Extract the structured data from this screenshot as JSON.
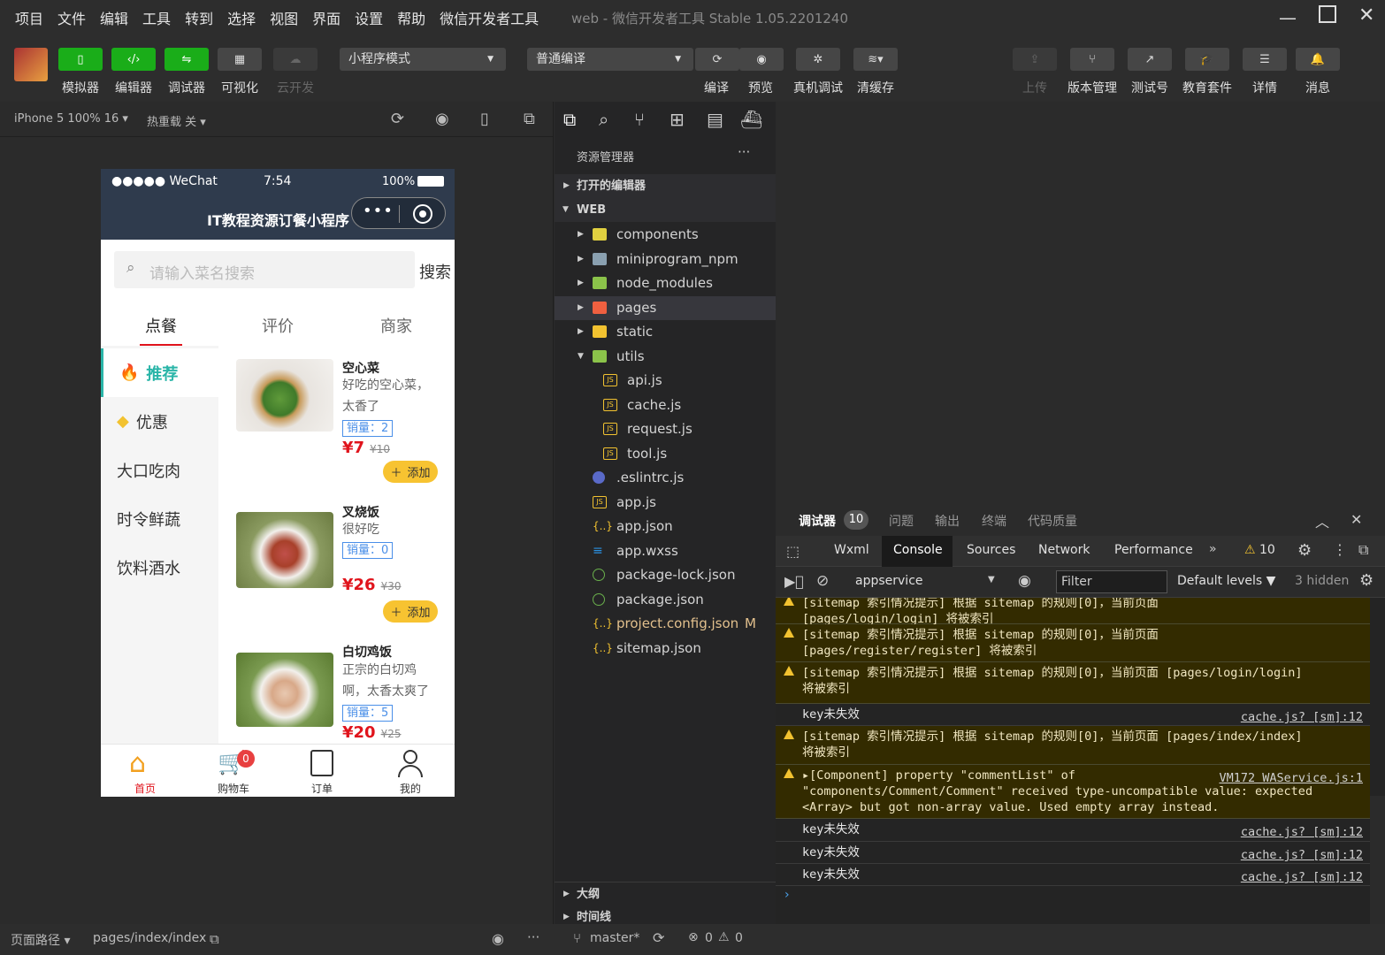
{
  "menu": [
    "项目",
    "文件",
    "编辑",
    "工具",
    "转到",
    "选择",
    "视图",
    "界面",
    "设置",
    "帮助",
    "微信开发者工具"
  ],
  "window_title": "web - 微信开发者工具 Stable 1.05.2201240",
  "toolbar": {
    "simulator": "模拟器",
    "editor": "编辑器",
    "debugger": "调试器",
    "visual": "可视化",
    "cloud": "云开发",
    "mode": "小程序模式",
    "compile_mode": "普通编译",
    "compile": "编译",
    "preview": "预览",
    "real_debug": "真机调试",
    "clear_cache": "清缓存",
    "upload": "上传",
    "version": "版本管理",
    "test_id": "测试号",
    "edu": "教育套件",
    "details": "详情",
    "messages": "消息"
  },
  "sim": {
    "device": "iPhone 5 100% 16 ▾",
    "hot_reload": "热重载 关 ▾"
  },
  "phone": {
    "carrier": "●●●●● WeChat",
    "time": "7:54",
    "battery": "100%",
    "title": "IT教程资源订餐小程序",
    "search_placeholder": "请输入菜名搜索",
    "search_btn": "搜索",
    "tabs": [
      "点餐",
      "评价",
      "商家"
    ],
    "categories": [
      "推荐",
      "优惠",
      "大口吃肉",
      "时令鲜蔬",
      "饮料酒水"
    ],
    "dishes": [
      {
        "name": "空心菜",
        "desc": "好吃的空心菜，太香了",
        "sales": "销量：2",
        "price": "¥7",
        "old": "¥10",
        "add": "添加"
      },
      {
        "name": "叉烧饭",
        "desc": "很好吃",
        "sales": "销量：0",
        "price": "¥26",
        "old": "¥30",
        "add": "添加"
      },
      {
        "name": "白切鸡饭",
        "desc": "正宗的白切鸡啊，太香太爽了",
        "sales": "销量：5",
        "price": "¥20",
        "old": "¥25"
      }
    ],
    "tabbar": [
      "首页",
      "购物车",
      "订单",
      "我的"
    ],
    "cart_badge": "0",
    "accent": "#e0141c"
  },
  "explorer": {
    "title": "资源管理器",
    "more": "···",
    "open_editors": "打开的编辑器",
    "root": "WEB",
    "items": [
      "components",
      "miniprogram_npm",
      "node_modules",
      "pages",
      "static",
      "utils",
      "api.js",
      "cache.js",
      "request.js",
      "tool.js",
      ".eslintrc.js",
      "app.js",
      "app.json",
      "app.wxss",
      "package-lock.json",
      "package.json",
      "project.config.json",
      "sitemap.json"
    ],
    "modified": "M",
    "outline": "大纲",
    "timeline": "时间线"
  },
  "devtools": {
    "top_tabs": [
      "调试器",
      "问题",
      "输出",
      "终端",
      "代码质量"
    ],
    "debugger_count": "10",
    "tabs": [
      "Wxml",
      "Console",
      "Sources",
      "Network",
      "Performance"
    ],
    "warn_count": "10",
    "context": "appservice",
    "filter_placeholder": "Filter",
    "levels": "Default levels ▼",
    "hidden": "3 hidden",
    "logs": [
      {
        "type": "warn",
        "text": "[sitemap 索引情况提示] 根据 sitemap 的规则[0]，当前页面\n[pages/login/login] 将被索引",
        "src": ""
      },
      {
        "type": "warn",
        "text": "[sitemap 索引情况提示] 根据 sitemap 的规则[0]，当前页面\n[pages/register/register] 将被索引",
        "src": ""
      },
      {
        "type": "warn",
        "text": "[sitemap 索引情况提示] 根据 sitemap 的规则[0]，当前页面 [pages/login/login]\n将被索引",
        "src": ""
      },
      {
        "type": "plain",
        "text": "key未失效",
        "src": "cache.js? [sm]:12"
      },
      {
        "type": "warn",
        "text": "[sitemap 索引情况提示] 根据 sitemap 的规则[0]，当前页面 [pages/index/index]\n将被索引",
        "src": ""
      },
      {
        "type": "warn",
        "text": "▸[Component] property \"commentList\" of\n\"components/Comment/Comment\" received type-uncompatible value: expected\n<Array> but got non-array value. Used empty array instead.",
        "src": "VM172 WAService.js:1"
      },
      {
        "type": "plain",
        "text": "key未失效",
        "src": "cache.js? [sm]:12"
      },
      {
        "type": "plain",
        "text": "key未失效",
        "src": "cache.js? [sm]:12"
      },
      {
        "type": "plain",
        "text": "key未失效",
        "src": "cache.js? [sm]:12"
      }
    ]
  },
  "status": {
    "path_label": "页面路径 ▾",
    "path": "pages/index/index",
    "branch": "master*",
    "errors": "0",
    "warnings": "0"
  }
}
